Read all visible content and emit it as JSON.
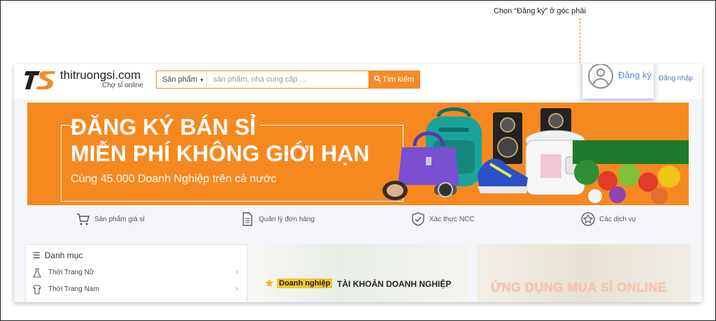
{
  "callout": {
    "text": "Chọn “Đăng ký” ở góc phải"
  },
  "header": {
    "logo_name": "thitruongsi.com",
    "logo_tagline": "Chợ sỉ online",
    "search": {
      "category": "Sản phẩm",
      "placeholder": "sản phẩm, nhà cung cấp ...",
      "button": "Tìm kiếm"
    },
    "register": "Đăng ký",
    "login": "Đăng nhập"
  },
  "banner": {
    "line1": "ĐĂNG KÝ BÁN SỈ",
    "line2": "MIỄN PHÍ KHÔNG GIỚI HẠN",
    "line3": "Cùng 45.000 Doanh Nghiệp trên cả nước"
  },
  "features": [
    {
      "label": "Sản phẩm giá sỉ",
      "icon": "cart-icon"
    },
    {
      "label": "Quản lý đơn hàng",
      "icon": "document-icon"
    },
    {
      "label": "Xác thực NCC",
      "icon": "shield-check-icon"
    },
    {
      "label": "Các dịch vụ",
      "icon": "star-badge-icon"
    }
  ],
  "categories": {
    "title": "Danh mục",
    "items": [
      {
        "label": "Thời Trang Nữ",
        "icon": "dress-icon"
      },
      {
        "label": "Thời Trang Nam",
        "icon": "shirt-icon"
      }
    ]
  },
  "promos": {
    "business_tag": "Doanh nghiệp",
    "business_title": "TÀI KHOẢN DOANH NGHIỆP",
    "app_title": "ỨNG DỤNG MUA SỈ ONLINE"
  },
  "colors": {
    "accent": "#f28c28",
    "banner": "#f5891f",
    "link": "#4a7cc0",
    "callout": "#e8681c"
  }
}
